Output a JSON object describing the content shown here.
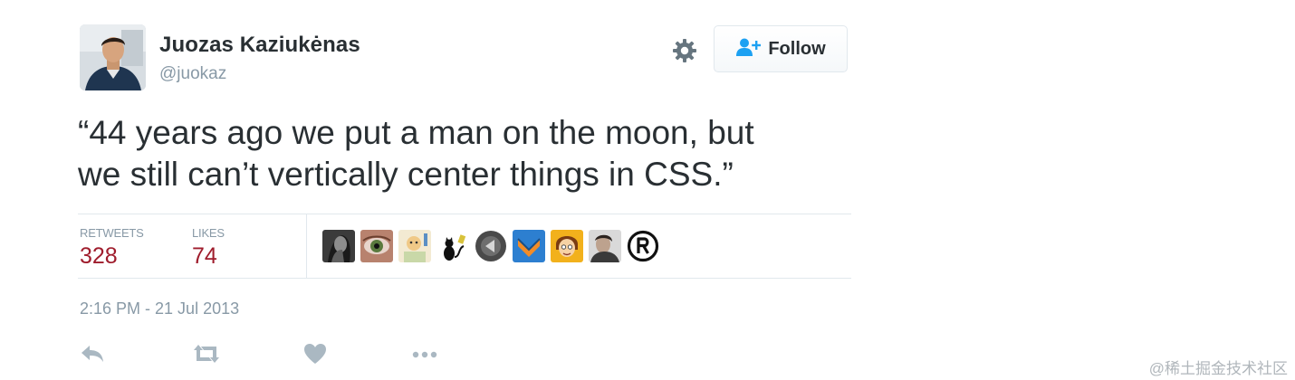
{
  "user": {
    "display_name": "Juozas Kaziukėnas",
    "handle": "@juokaz"
  },
  "follow_button": {
    "label": "Follow"
  },
  "tweet": {
    "line1": "“44 years ago we put a man on the moon, but",
    "line2": "we still can’t vertically center things in CSS.”"
  },
  "stats": {
    "retweets_label": "RETWEETS",
    "retweets_count": "328",
    "likes_label": "LIKES",
    "likes_count": "74"
  },
  "timestamp": "2:16 PM - 21 Jul 2013",
  "actions": [
    "reply-icon",
    "retweet-icon",
    "like-icon",
    "more-icon"
  ],
  "watermark": "@稀土掘金技术社区",
  "colors": {
    "count": "#9f1c2c",
    "muted": "#8899a6",
    "follow_icon": "#1da1f2",
    "text": "#292f33"
  }
}
